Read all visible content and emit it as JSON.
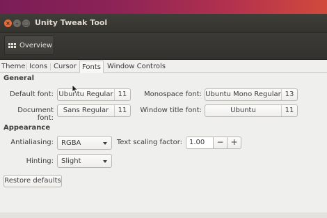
{
  "window": {
    "title": "Unity Tweak Tool",
    "close_glyph": "×",
    "min_glyph": "–",
    "max_glyph": "□"
  },
  "toolbar": {
    "overview_label": "Overview",
    "overview_icon": "grid-icon"
  },
  "tabs": [
    {
      "label": "Theme"
    },
    {
      "label": "Icons"
    },
    {
      "label": "Cursor"
    },
    {
      "label": "Fonts",
      "active": true
    },
    {
      "label": "Window Controls"
    }
  ],
  "general": {
    "heading": "General",
    "default_font": {
      "label": "Default font:",
      "name": "Ubuntu Regular",
      "size": "11"
    },
    "document_font": {
      "label": "Document font:",
      "name": "Sans Regular",
      "size": "11"
    },
    "monospace_font": {
      "label": "Monospace font:",
      "name": "Ubuntu Mono Regular",
      "size": "13"
    },
    "window_title_font": {
      "label": "Window title font:",
      "name": "Ubuntu",
      "size": "11"
    }
  },
  "appearance": {
    "heading": "Appearance",
    "antialiasing": {
      "label": "Antialiasing:",
      "value": "RGBA"
    },
    "hinting": {
      "label": "Hinting:",
      "value": "Slight"
    },
    "text_scaling": {
      "label": "Text scaling factor:",
      "value": "1.00",
      "minus": "−",
      "plus": "+"
    }
  },
  "restore_label": "Restore defaults",
  "colors": {
    "titlebar": "#3e3d38",
    "close_button": "#e66d3a",
    "window_bg": "#efefee"
  }
}
